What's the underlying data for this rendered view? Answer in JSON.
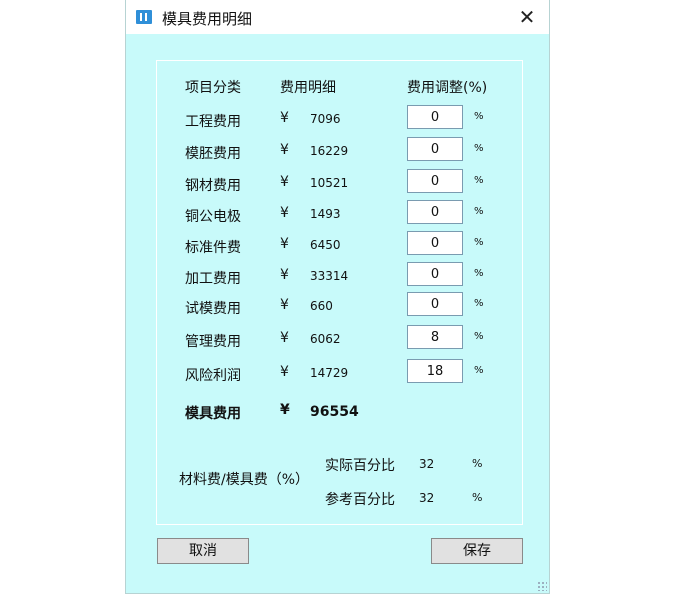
{
  "window": {
    "title": "模具费用明细",
    "close_glyph": "✕"
  },
  "headers": {
    "category": "项目分类",
    "detail": "费用明细",
    "adjust": "费用调整(%)"
  },
  "rows": [
    {
      "label": "工程费用",
      "currency": "¥",
      "amount": "7096",
      "adjust": "0",
      "unit": "%"
    },
    {
      "label": "模胚费用",
      "currency": "¥",
      "amount": "16229",
      "adjust": "0",
      "unit": "%"
    },
    {
      "label": "钢材费用",
      "currency": "¥",
      "amount": "10521",
      "adjust": "0",
      "unit": "%"
    },
    {
      "label": "铜公电极",
      "currency": "¥",
      "amount": "1493",
      "adjust": "0",
      "unit": "%"
    },
    {
      "label": "标准件费",
      "currency": "¥",
      "amount": "6450",
      "adjust": "0",
      "unit": "%"
    },
    {
      "label": "加工费用",
      "currency": "¥",
      "amount": "33314",
      "adjust": "0",
      "unit": "%"
    },
    {
      "label": "试模费用",
      "currency": "¥",
      "amount": "660",
      "adjust": "0",
      "unit": "%"
    },
    {
      "label": "管理费用",
      "currency": "¥",
      "amount": "6062",
      "adjust": "8",
      "unit": "%"
    },
    {
      "label": "风险利润",
      "currency": "¥",
      "amount": "14729",
      "adjust": "18",
      "unit": "%"
    }
  ],
  "total": {
    "label": "模具费用",
    "currency": "¥",
    "amount": "96554"
  },
  "ratio": {
    "title": "材料费/模具费（%）",
    "actual_label": "实际百分比",
    "actual_value": "32",
    "reference_label": "参考百分比",
    "reference_value": "32",
    "unit": "%"
  },
  "buttons": {
    "cancel": "取消",
    "save": "保存"
  },
  "colors": {
    "background": "#c8fafa",
    "titlebar": "#ffffff",
    "button": "#e1e1e1"
  }
}
